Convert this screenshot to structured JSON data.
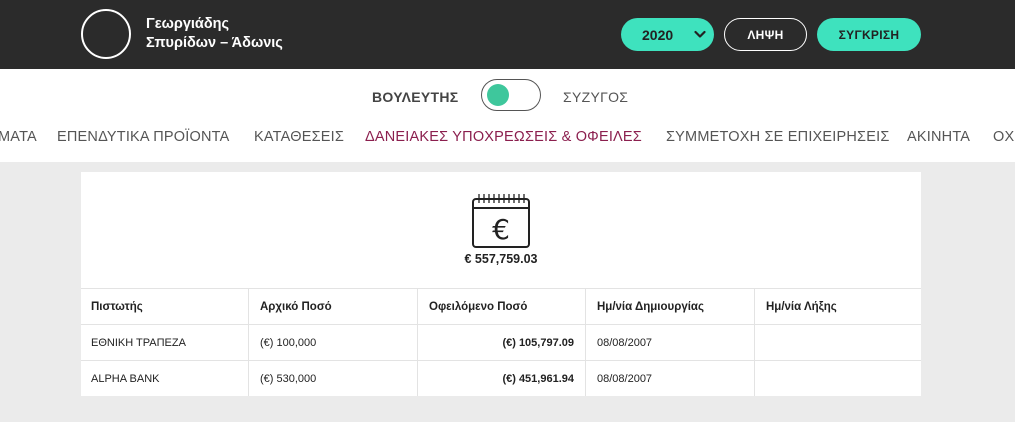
{
  "header": {
    "name_line1": "Γεωργιάδης",
    "name_line2": "Σπυρίδων – Άδωνις",
    "year": "2020",
    "download_label": "ΛΗΨΗ",
    "compare_label": "ΣΥΓΚΡΙΣΗ"
  },
  "toggle": {
    "left_label": "ΒΟΥΛΕΥΤΗΣ",
    "right_label": "ΣΥΖΥΓΟΣ"
  },
  "tabs": [
    "ΜΑΤΑ",
    "ΕΠΕΝΔΥΤΙΚΑ ΠΡΟΪΟΝΤΑ",
    "ΚΑΤΑΘΕΣΕΙΣ",
    "ΔΑΝΕΙΑΚΕΣ ΥΠΟΧΡΕΩΣΕΙΣ & ΟΦΕΙΛΕΣ",
    "ΣΥΜΜΕΤΟΧΗ ΣΕ ΕΠΙΧΕΙΡΗΣΕΙΣ",
    "ΑΚΙΝΗΤΑ",
    "ΟΧ"
  ],
  "active_tab": "ΔΑΝΕΙΑΚΕΣ ΥΠΟΧΡΕΩΣΕΙΣ & ΟΦΕΙΛΕΣ",
  "summary": {
    "icon": "euro-calendar-icon",
    "total": "€ 557,759.03"
  },
  "table": {
    "columns": [
      "Πιστωτής",
      "Αρχικό Ποσό",
      "Οφειλόμενο Ποσό",
      "Ημ/νία Δημιουργίας",
      "Ημ/νία Λήξης"
    ],
    "rows": [
      [
        "ΕΘΝΙΚΗ ΤΡΑΠΕΖΑ",
        "(€) 100,000",
        "(€) 105,797.09",
        "08/08/2007",
        ""
      ],
      [
        "ALPHA BANK",
        "(€) 530,000",
        "(€) 451,961.94",
        "08/08/2007",
        ""
      ]
    ]
  },
  "colors": {
    "accent": "#3ee2be",
    "active_tab": "#8b1f4e",
    "topbar": "#2b2b2b",
    "toggle_knob": "#3ec79c"
  }
}
